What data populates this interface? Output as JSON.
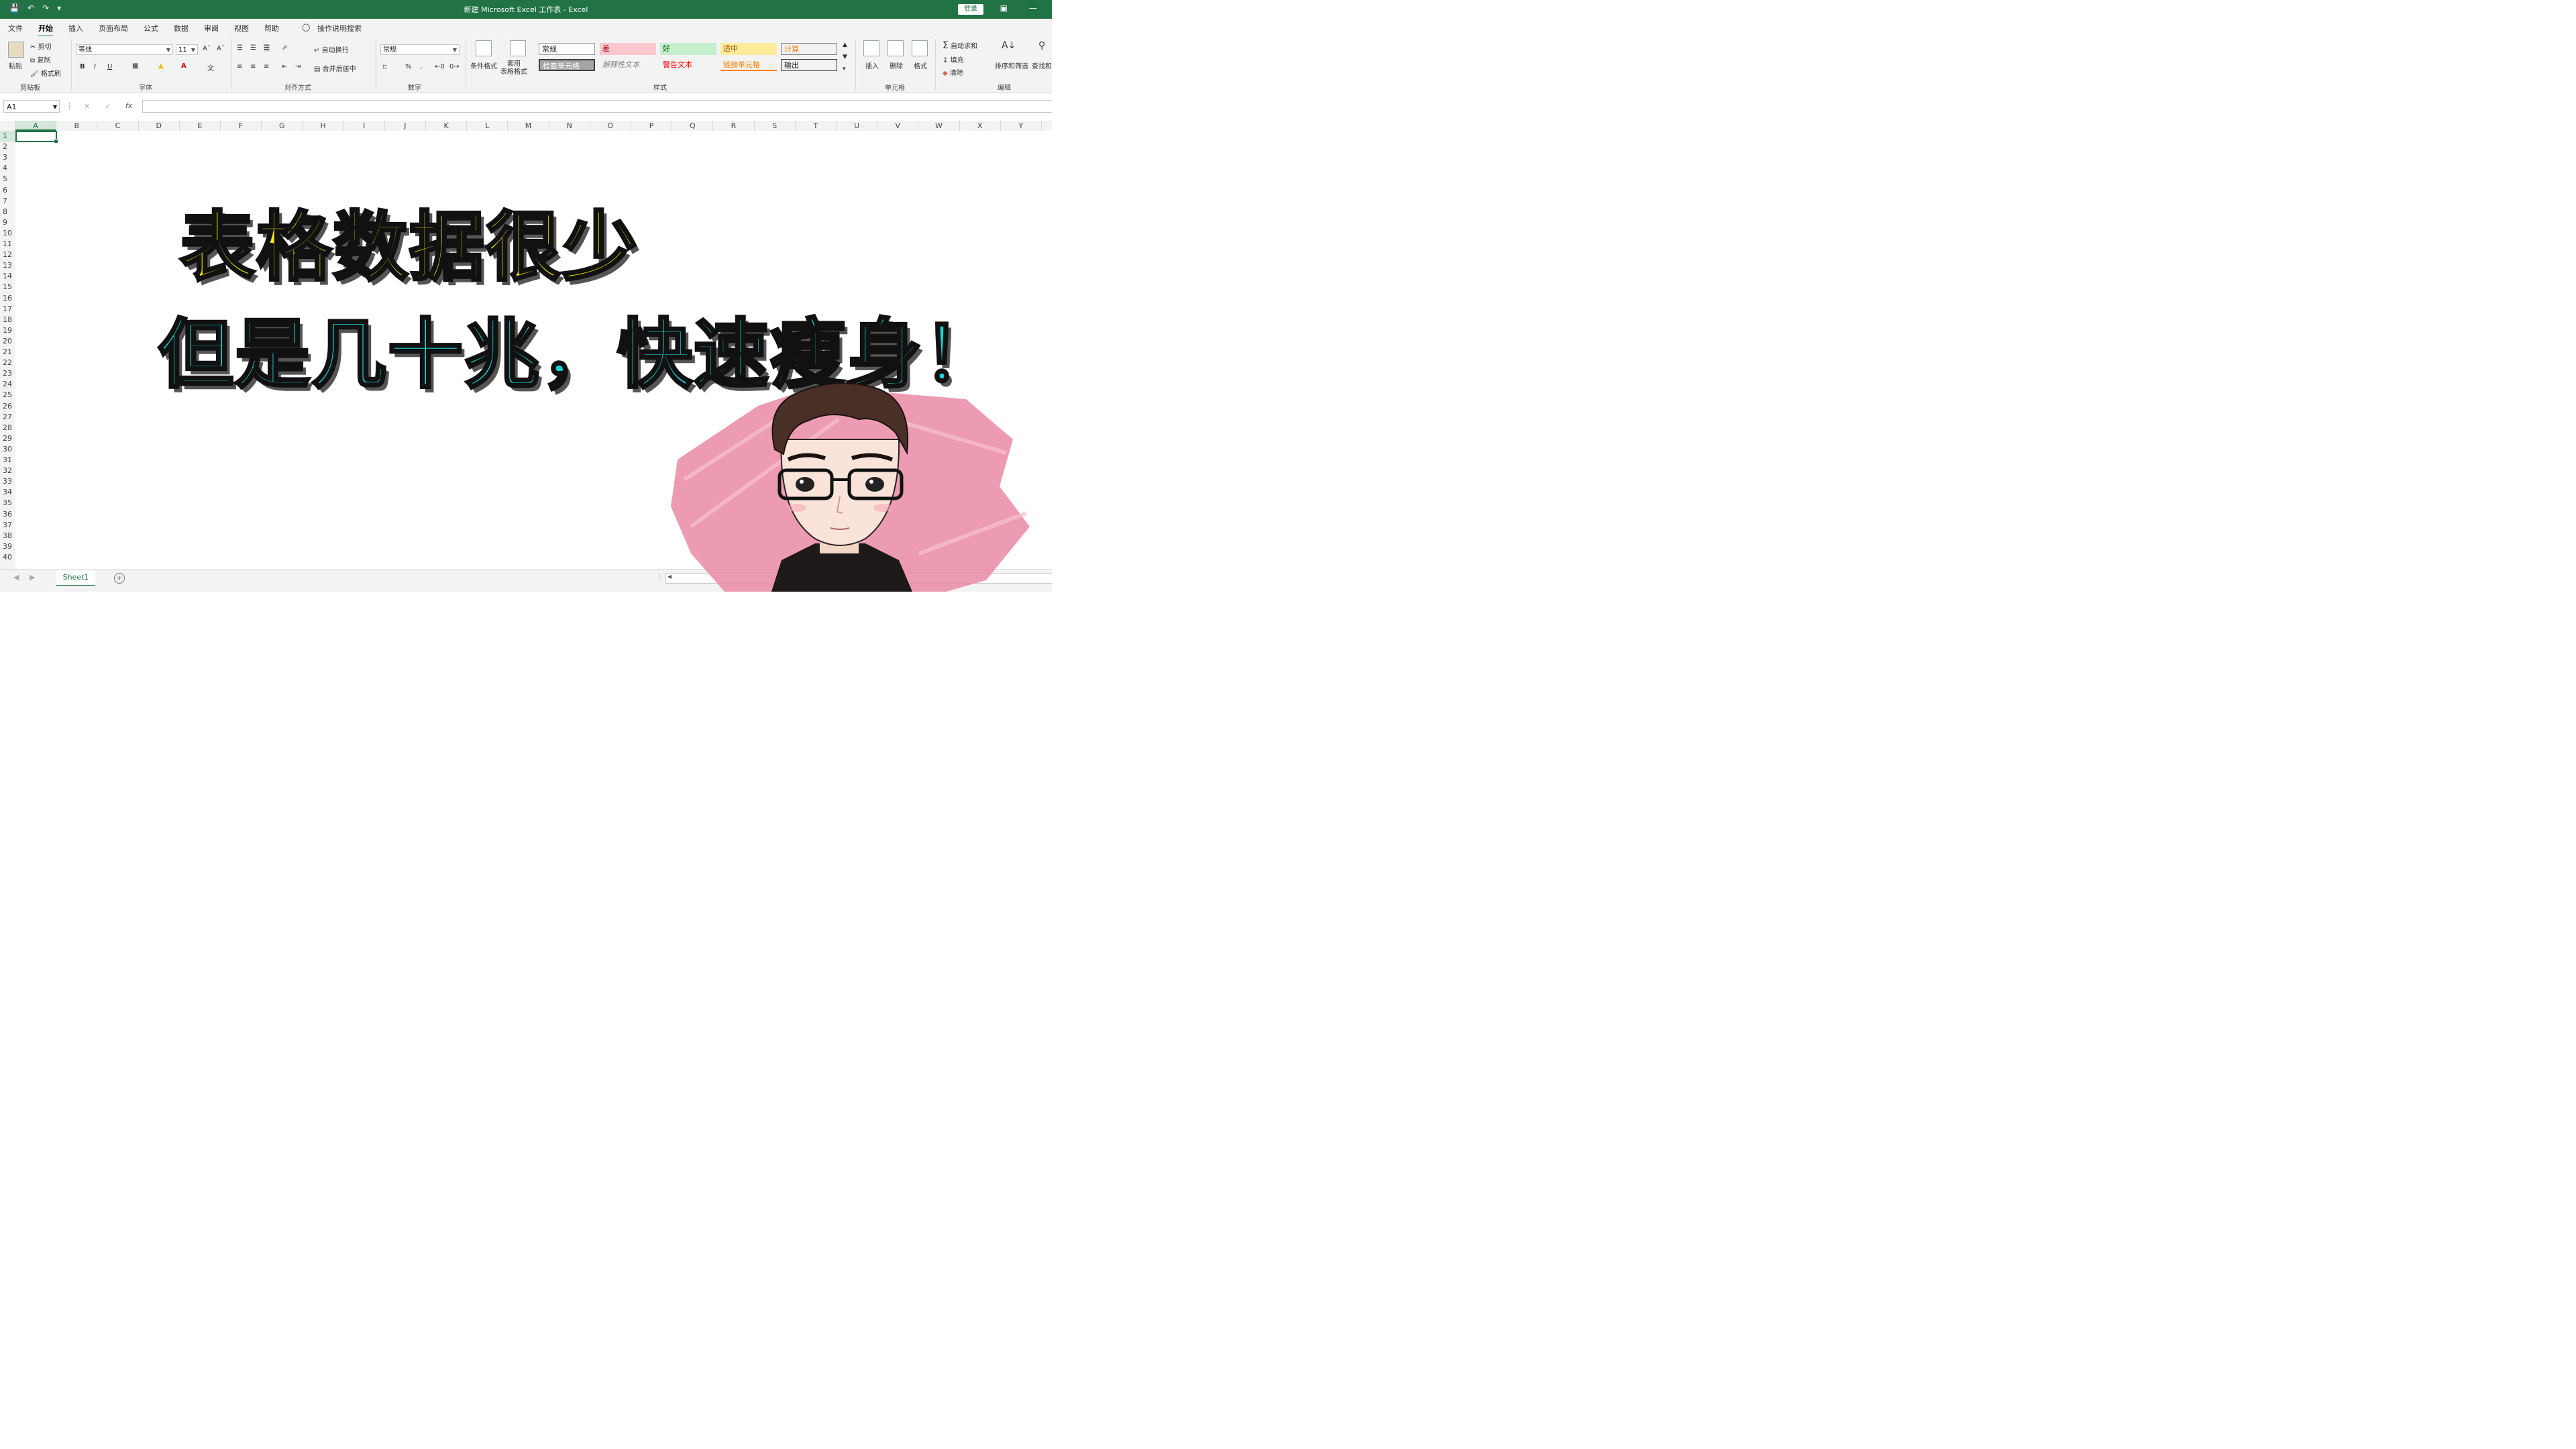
{
  "window": {
    "title": "新建 Microsoft Excel 工作表  -  Excel",
    "login": "登录"
  },
  "menu_tabs": [
    "文件",
    "开始",
    "插入",
    "页面布局",
    "公式",
    "数据",
    "审阅",
    "视图",
    "帮助"
  ],
  "tell_me": "操作说明搜索",
  "ribbon": {
    "clipboard": {
      "paste": "粘贴",
      "cut": "剪切",
      "copy": "复制",
      "format_painter": "格式刷",
      "label": "剪贴板"
    },
    "font": {
      "name": "等线",
      "size": "11",
      "bold": "B",
      "italic": "I",
      "underline": "U",
      "label": "字体"
    },
    "alignment": {
      "wrap": "自动换行",
      "merge": "合并后居中",
      "label": "对齐方式"
    },
    "number": {
      "format": "常规",
      "percent": "%",
      "comma": ",",
      "label": "数字"
    },
    "styles": {
      "conditional": "条件格式",
      "table": "套用\n表格格式",
      "cells": [
        "常规",
        "差",
        "好",
        "适中",
        "计算",
        "检查单元格",
        "解释性文本",
        "警告文本",
        "链接单元格",
        "输出"
      ],
      "label": "样式"
    },
    "cells": {
      "insert": "插入",
      "delete": "删除",
      "format": "格式",
      "label": "单元格"
    },
    "editing": {
      "autosum": "自动求和",
      "fill": "填充",
      "clear": "清除",
      "sort": "排序和筛选",
      "find": "查找和",
      "label": "编辑"
    }
  },
  "formula_bar": {
    "name_box": "A1",
    "fx": "fx",
    "value": ""
  },
  "columns": [
    "A",
    "B",
    "C",
    "D",
    "E",
    "F",
    "G",
    "H",
    "I",
    "J",
    "K",
    "L",
    "M",
    "N",
    "O",
    "P",
    "Q",
    "R",
    "S",
    "T",
    "U",
    "V",
    "W",
    "X",
    "Y"
  ],
  "rows": [
    "1",
    "2",
    "3",
    "4",
    "5",
    "6",
    "7",
    "8",
    "9",
    "10",
    "11",
    "12",
    "13",
    "14",
    "15",
    "16",
    "17",
    "18",
    "19",
    "20",
    "21",
    "22",
    "23",
    "24",
    "25",
    "26",
    "27",
    "28",
    "29",
    "30",
    "31",
    "32",
    "33",
    "34",
    "35",
    "36",
    "37",
    "38",
    "39",
    "40"
  ],
  "sheet_tab": "Sheet1",
  "overlay": {
    "line1": "表格数据很少",
    "line2": "但是几十兆，快速瘦身！"
  },
  "colors": {
    "excel_green": "#217346",
    "caption_yellow": "#f7e600",
    "caption_cyan": "#18d4d6",
    "splash_pink": "#e98aa6"
  }
}
